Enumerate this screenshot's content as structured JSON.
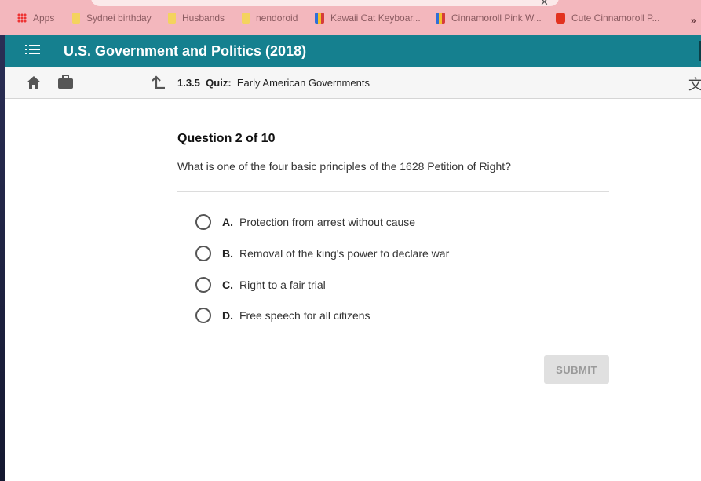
{
  "browser": {
    "bookmarks": [
      {
        "label": "Apps",
        "icon": "apps-grid-icon"
      },
      {
        "label": "Sydnei birthday",
        "icon": "folder-icon"
      },
      {
        "label": "Husbands",
        "icon": "folder-icon"
      },
      {
        "label": "nendoroid",
        "icon": "folder-icon"
      },
      {
        "label": "Kawaii Cat Keyboar...",
        "icon": "shopping-bag-icon"
      },
      {
        "label": "Cinnamoroll Pink W...",
        "icon": "shopping-bag-icon"
      },
      {
        "label": "Cute Cinnamoroll P...",
        "icon": "aliexpress-icon"
      }
    ],
    "more_label": "»"
  },
  "header": {
    "course_title": "U.S. Government and Politics (2018)",
    "accent_color": "#15808f"
  },
  "subbar": {
    "lesson_number": "1.3.5",
    "lesson_type": "Quiz:",
    "lesson_name": "Early American Governments",
    "translate_glyph": "文"
  },
  "question": {
    "title": "Question 2 of 10",
    "text": "What is one of the four basic principles of the 1628 Petition of Right?",
    "options": [
      {
        "letter": "A.",
        "text": "Protection from arrest without cause"
      },
      {
        "letter": "B.",
        "text": "Removal of the king's power to declare war"
      },
      {
        "letter": "C.",
        "text": "Right to a fair trial"
      },
      {
        "letter": "D.",
        "text": "Free speech for all citizens"
      }
    ],
    "submit_label": "SUBMIT"
  }
}
